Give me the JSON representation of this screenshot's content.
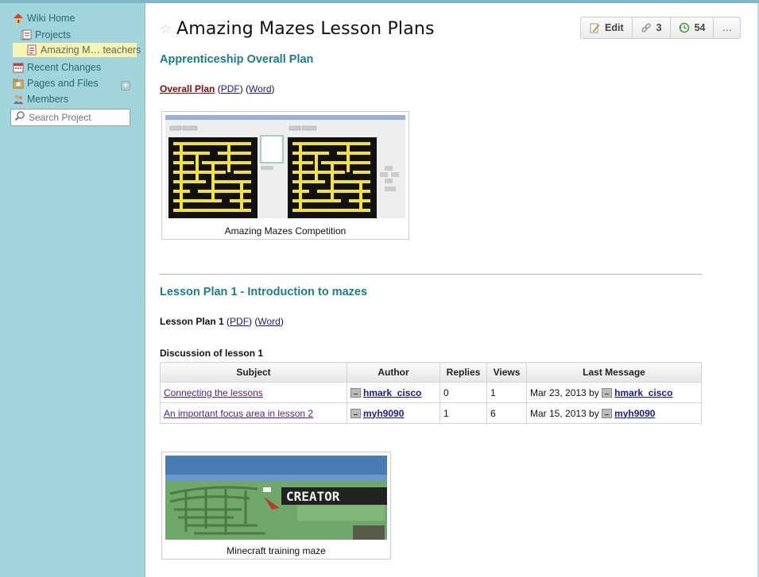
{
  "sidebar": {
    "items": [
      {
        "label": "Wiki Home",
        "icon": "house-icon"
      },
      {
        "label": "Projects",
        "icon": "projects-icon"
      },
      {
        "label": "Amazing M… teachers",
        "icon": "page-icon"
      },
      {
        "label": "Recent Changes",
        "icon": "calendar-icon"
      },
      {
        "label": "Pages and Files",
        "icon": "files-icon"
      },
      {
        "label": "Members",
        "icon": "members-icon"
      }
    ],
    "search_placeholder": "Search Project",
    "add_label": "+"
  },
  "header": {
    "title": "Amazing Mazes Lesson Plans",
    "star": "☆",
    "toolbar": {
      "edit": "Edit",
      "links_count": "3",
      "history_count": "54",
      "more": "…"
    }
  },
  "section1": {
    "heading": "Apprenticeship Overall Plan",
    "plan_label": "Overall Plan",
    "pdf": "PDF",
    "word": "Word",
    "image_caption": "Amazing Mazes Competition"
  },
  "section2": {
    "heading": "Lesson Plan 1 - Introduction to mazes",
    "plan_label": "Lesson Plan 1",
    "pdf": "PDF",
    "word": "Word",
    "discussion_title": "Discussion of lesson 1",
    "table": {
      "headers": [
        "Subject",
        "Author",
        "Replies",
        "Views",
        "Last Message"
      ],
      "rows": [
        {
          "subject": "Connecting the lessons",
          "author": "hmark_cisco",
          "replies": "0",
          "views": "1",
          "last_date": "Mar 23, 2013 by",
          "last_user": "hmark_cisco"
        },
        {
          "subject": "An important focus area in lesson 2",
          "author": "myh9090",
          "replies": "1",
          "views": "6",
          "last_date": "Mar 15, 2013 by",
          "last_user": "myh9090"
        }
      ]
    },
    "image_caption": "Minecraft training maze",
    "image_sign": "CREATOR"
  }
}
